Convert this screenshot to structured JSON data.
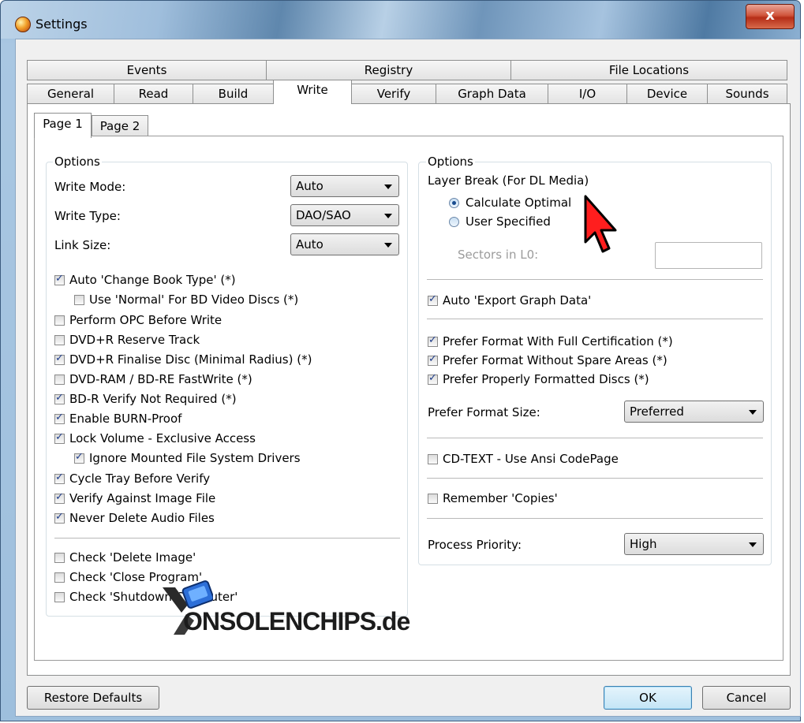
{
  "window": {
    "title": "Settings",
    "close_label": "x"
  },
  "tabs_row1": [
    "Events",
    "Registry",
    "File Locations"
  ],
  "tabs_row2": [
    "General",
    "Read",
    "Build",
    "Write",
    "Verify",
    "Graph Data",
    "I/O",
    "Device",
    "Sounds"
  ],
  "active_tab": "Write",
  "subtabs": [
    "Page 1",
    "Page 2"
  ],
  "left": {
    "legend": "Options",
    "write_mode_label": "Write Mode:",
    "write_mode_value": "Auto",
    "write_type_label": "Write Type:",
    "write_type_value": "DAO/SAO",
    "link_size_label": "Link Size:",
    "link_size_value": "Auto",
    "checkboxes": [
      {
        "label": "Auto 'Change Book Type' (*)",
        "checked": true
      },
      {
        "label": "Use 'Normal' For BD Video Discs (*)",
        "checked": false
      },
      {
        "label": "Perform OPC Before Write",
        "checked": false
      },
      {
        "label": "DVD+R Reserve Track",
        "checked": false
      },
      {
        "label": "DVD+R Finalise Disc (Minimal Radius) (*)",
        "checked": true
      },
      {
        "label": "DVD-RAM / BD-RE FastWrite (*)",
        "checked": false
      },
      {
        "label": "BD-R Verify Not Required (*)",
        "checked": true
      },
      {
        "label": "Enable BURN-Proof",
        "checked": true
      },
      {
        "label": "Lock Volume - Exclusive Access",
        "checked": true
      },
      {
        "label": "Ignore Mounted File System Drivers",
        "checked": true
      },
      {
        "label": "Cycle Tray Before Verify",
        "checked": true
      },
      {
        "label": "Verify Against Image File",
        "checked": true
      },
      {
        "label": "Never Delete Audio Files",
        "checked": true
      },
      {
        "label": "Check 'Delete Image'",
        "checked": false
      },
      {
        "label": "Check 'Close Program'",
        "checked": false
      },
      {
        "label": "Check 'Shutdown Computer'",
        "checked": false
      }
    ]
  },
  "right": {
    "legend": "Options",
    "layer_break_label": "Layer Break (For DL Media)",
    "radio_calculate": "Calculate Optimal",
    "radio_user": "User Specified",
    "sectors_label": "Sectors in L0:",
    "export_graph": "Auto 'Export Graph Data'",
    "prefer_full_cert": "Prefer Format With Full Certification (*)",
    "prefer_no_spare": "Prefer Format Without Spare Areas (*)",
    "prefer_properly": "Prefer Properly Formatted Discs (*)",
    "prefer_size_label": "Prefer Format Size:",
    "prefer_size_value": "Preferred",
    "cdtext": "CD-TEXT - Use Ansi CodePage",
    "remember_copies": "Remember 'Copies'",
    "priority_label": "Process Priority:",
    "priority_value": "High"
  },
  "buttons": {
    "restore": "Restore Defaults",
    "ok": "OK",
    "cancel": "Cancel"
  },
  "watermark": {
    "text": "ONSOLENCHIPS.de"
  }
}
